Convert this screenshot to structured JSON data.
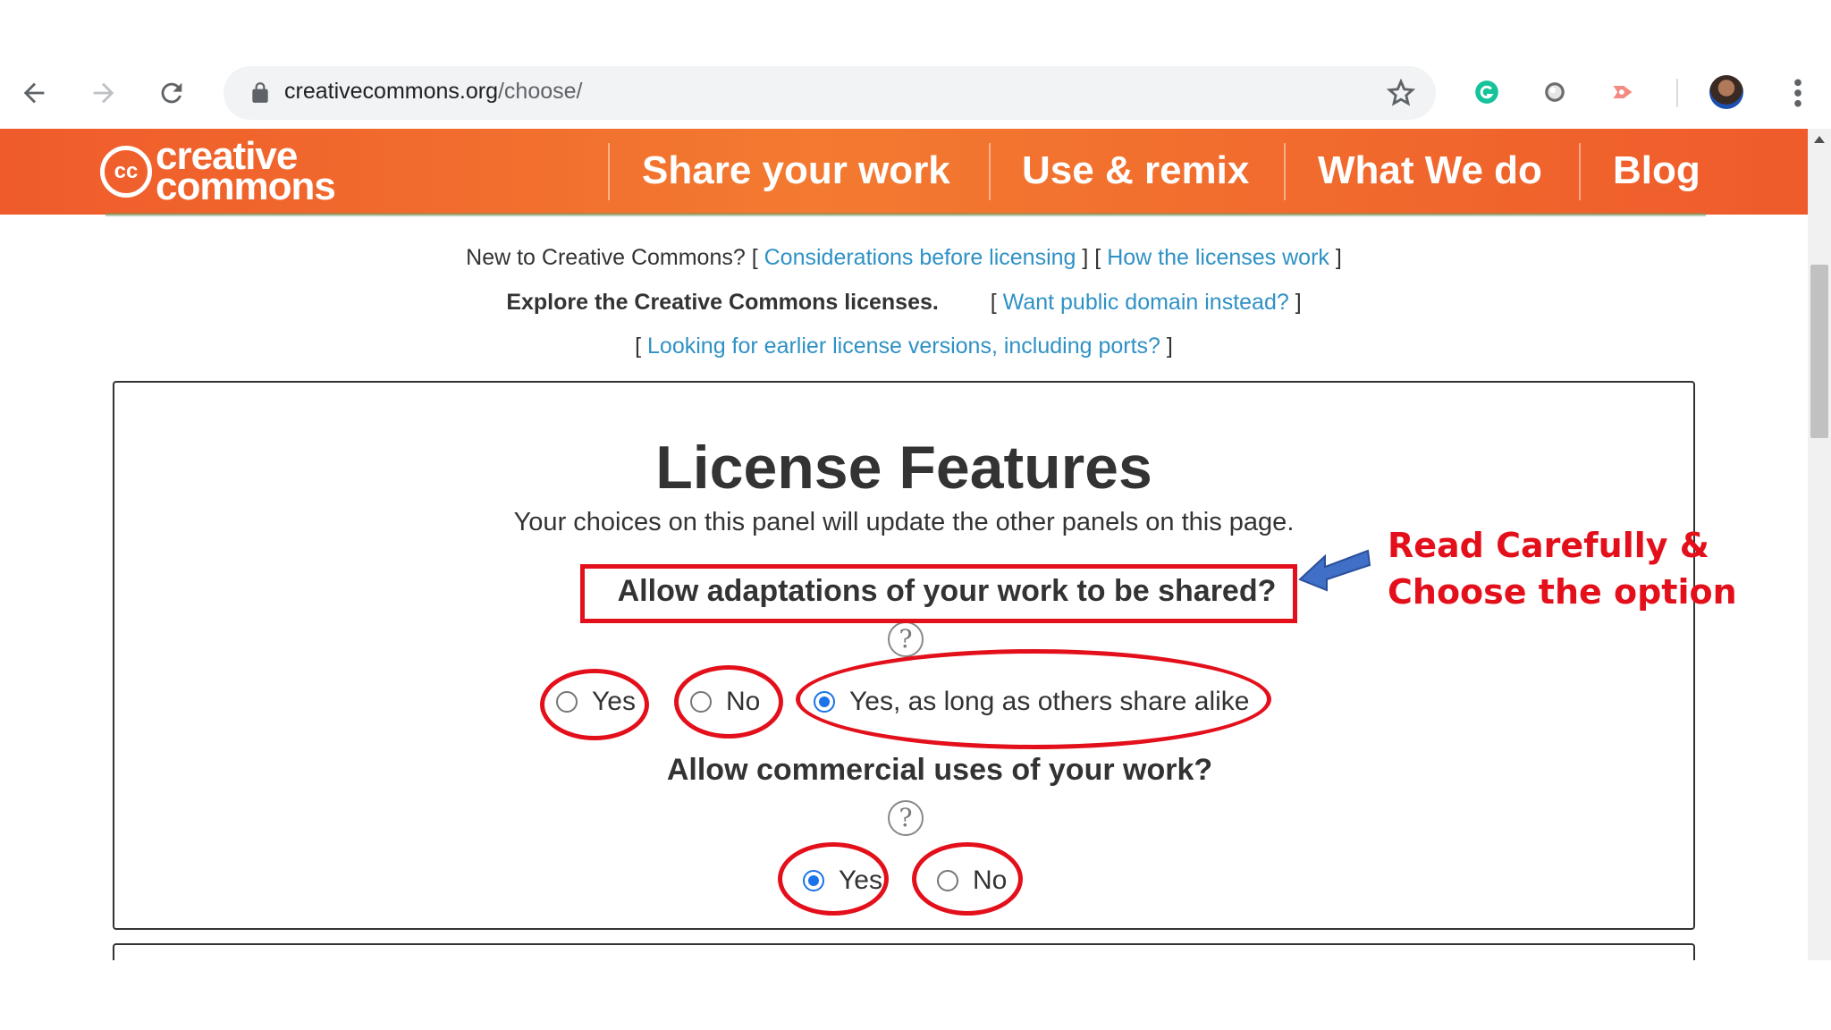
{
  "browser": {
    "url_host": "creativecommons.org",
    "url_path": "/choose/"
  },
  "site": {
    "logo_abbr": "cc",
    "logo_line1": "creative",
    "logo_line2": "commons",
    "nav": [
      "Share your work",
      "Use & remix",
      "What We do",
      "Blog"
    ]
  },
  "intro": {
    "line1_prefix": "New to Creative Commons? [",
    "link_considerations": "Considerations before licensing",
    "line1_mid": "] [",
    "link_how": "How the licenses work",
    "line1_suffix": "]",
    "explore": "Explore the Creative Commons licenses.",
    "bracket_open": "[",
    "link_public_domain": "Want public domain instead?",
    "bracket_close": "]",
    "link_earlier": "Looking for earlier license versions, including ports?"
  },
  "panel": {
    "title": "License Features",
    "subtitle": "Your choices on this panel will update the other panels on this page.",
    "q1": {
      "label": "Allow adaptations of your work to be shared?",
      "help": "?",
      "options": [
        "Yes",
        "No",
        "Yes, as long as others share alike"
      ],
      "selected": "Yes, as long as others share alike"
    },
    "q2": {
      "label": "Allow commercial uses of your work?",
      "help": "?",
      "options": [
        "Yes",
        "No"
      ],
      "selected": "Yes"
    }
  },
  "annotation": {
    "line1": "Read Carefully &",
    "line2": "Choose the option",
    "color": "#e3101b",
    "arrow_color": "#3f6fc6"
  },
  "colors": {
    "header_orange": "#ef5b2b",
    "link_blue": "#2f91c5",
    "radio_blue": "#1a73e8"
  }
}
